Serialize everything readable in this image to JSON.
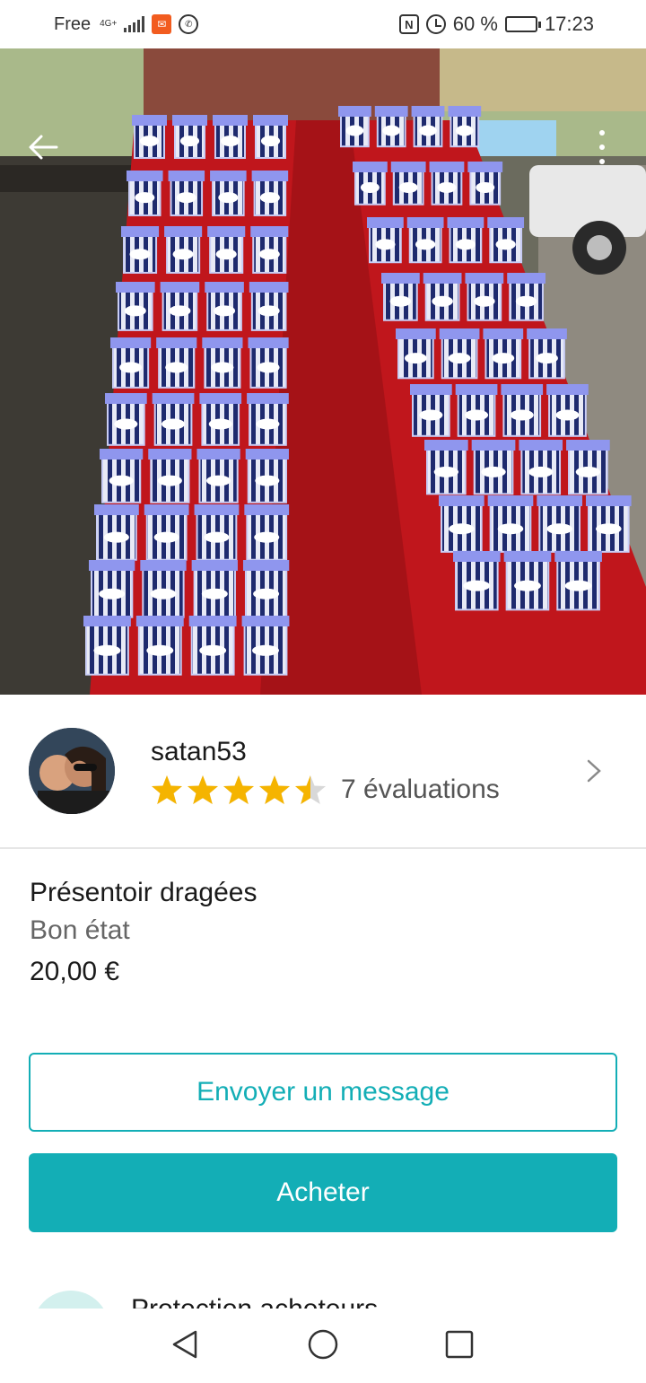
{
  "status_bar": {
    "carrier": "Free",
    "network": "4G+",
    "battery": "60 %",
    "battery_level": 0.6,
    "time": "17:23",
    "icons": [
      "signal-icon",
      "app-notification-icon",
      "whatsapp-icon",
      "nfc-icon",
      "alarm-icon",
      "battery-icon"
    ]
  },
  "hero": {
    "image_name": "listing-photo",
    "back_icon": "arrow-left-icon",
    "more_icon": "more-vertical-icon"
  },
  "seller": {
    "username": "satan53",
    "rating": 4.5,
    "rating_max": 5,
    "reviews_label": "7 évaluations",
    "star_color": "#f5b400",
    "chevron_icon": "chevron-right-icon"
  },
  "item": {
    "title": "Présentoir dragées",
    "condition": "Bon état",
    "price": "20,00 €"
  },
  "actions": {
    "message_label": "Envoyer un message",
    "buy_label": "Acheter",
    "accent_color": "#13aeb6"
  },
  "protection": {
    "label": "Protection acheteurs"
  },
  "nav": {
    "icons": [
      "nav-back-icon",
      "nav-home-icon",
      "nav-recents-icon"
    ]
  }
}
